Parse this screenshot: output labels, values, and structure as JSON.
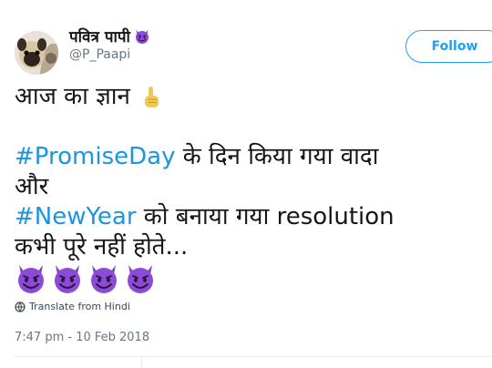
{
  "user": {
    "display_name": "पवित्र पापी",
    "handle": "@P_Paapi"
  },
  "follow_button": {
    "label": "Follow"
  },
  "tweet": {
    "line1": "आज का ज्ञान",
    "line2_hashtag": "#PromiseDay",
    "line2_rest": " के दिन किया गया वादा",
    "line3": "और",
    "line4_hashtag": "#NewYear",
    "line4_rest": " को बनाया गया resolution",
    "line5": "कभी पूरे नहीं होते..."
  },
  "translate": {
    "label": "Translate from Hindi"
  },
  "timestamp": "7:47 pm - 10 Feb 2018",
  "colors": {
    "accent": "#1da1f2",
    "hashtag": "#1b95e0",
    "devil_purple": "#8b4bd6"
  },
  "icons": [
    "smiling-devil-emoji",
    "pointing-up-emoji",
    "globe-icon"
  ]
}
